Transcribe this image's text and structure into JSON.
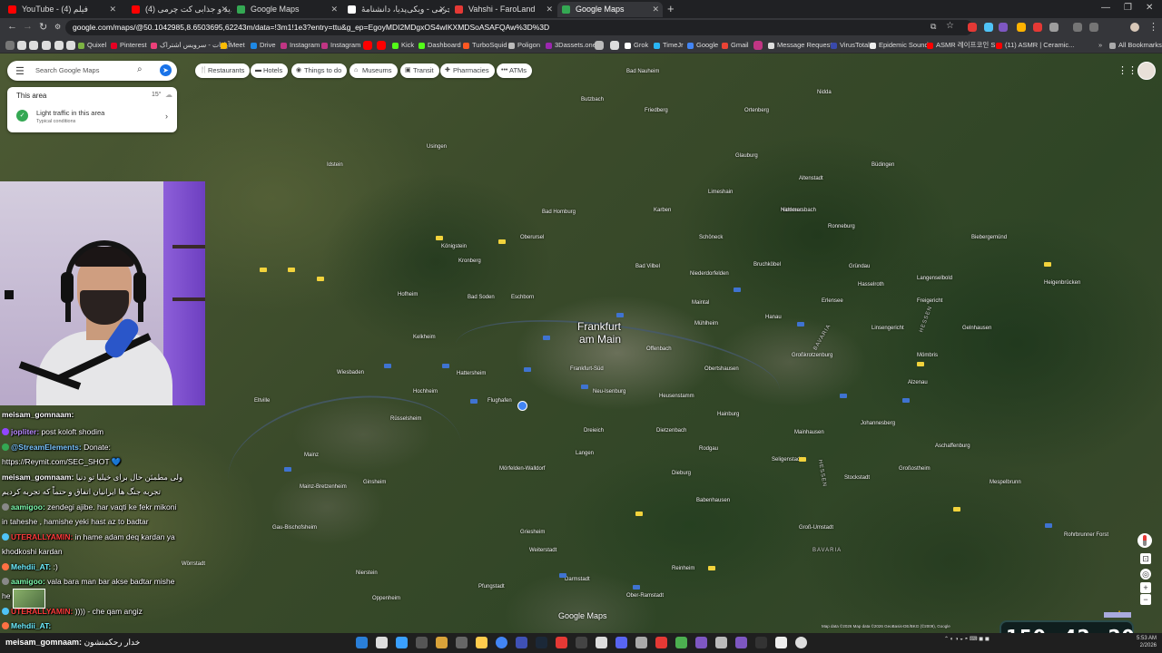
{
  "browser": {
    "tabs": [
      {
        "title": "YouTube - فیلم (4)",
        "color": "#ff0000",
        "active": false
      },
      {
        "title": "فیلم جدید و جذابی کت چرمی (4)",
        "color": "#ff0000",
        "active": false
      },
      {
        "title": "Google Maps",
        "color": "#34a853",
        "active": false
      },
      {
        "title": "کت چرمی - ویکی‌پدیا، دانشنامهٔ",
        "color": "#ffffff",
        "active": false
      },
      {
        "title": "Vahshi - FaroLand",
        "color": "#e53935",
        "active": false
      },
      {
        "title": "Google Maps",
        "color": "#34a853",
        "active": true
      }
    ],
    "url": "google.com/maps/@50.1042985,8.6503695,62243m/data=!3m1!1e3?entry=ttu&g_ep=EgoyMDI2MDgxOS4wIKXMDSoASAFQAw%3D%3D",
    "bookmarks": [
      "Quixel",
      "Pinterest",
      "آپارات - سرویس اشتراک",
      "Meet",
      "Drive",
      "Instagram",
      "Instagram",
      "Kick",
      "Dashboard",
      "TurboSquid",
      "Poligon",
      "3Dassets.one",
      "Grok",
      "TimeJr",
      "Google",
      "Gmail",
      "Message Requests",
      "VirusTotal",
      "Epidemic Sound",
      "ASMR 레이프코인 S...",
      "(11) ASMR | Ceramic...",
      "All Bookmarks"
    ]
  },
  "maps": {
    "search_placeholder": "Search Google Maps",
    "chips": [
      "Restaurants",
      "Hotels",
      "Things to do",
      "Museums",
      "Transit",
      "Pharmacies",
      "ATMs"
    ],
    "area_card": {
      "title": "This area",
      "temp": "15°",
      "traffic": "Light traffic in this area",
      "conditions": "Typical conditions"
    },
    "logo": "Google Maps",
    "attribution": "Map data ©2026  Map data ©2026 GeoBasis-DE/BKG (©2009), Google",
    "cities": {
      "main1": "Frankfurt",
      "main2": "am Main"
    },
    "towns": [
      "Bad Nauheim",
      "Friedberg",
      "Bad Homburg",
      "Oberursel",
      "Königstein",
      "Kronberg",
      "Bad Soden",
      "Eschborn",
      "Wiesbaden",
      "Mainz",
      "Hanau",
      "Offenbach",
      "Darmstadt",
      "Neu-Isenburg",
      "Dreieich",
      "Langen",
      "Rüsselsheim",
      "Flughafen",
      "Hofheim",
      "Karben",
      "Bad Vilbel",
      "Maintal",
      "Bruchköbel",
      "Dietzenbach",
      "Seligenstadt",
      "Babenhausen",
      "Rodgau",
      "Mörfelden-Walldorf",
      "Idstein",
      "Usingen",
      "Butzbach",
      "Gelnhausen",
      "Alzenau",
      "Aschaffenburg",
      "Dieburg",
      "Groß-Umstadt",
      "Griesheim",
      "Weiterstadt",
      "Nidda",
      "Büdingen",
      "Langenselbold",
      "Erlensee",
      "Nidderau",
      "Schöneck",
      "Niederdorfelden",
      "Obertshausen",
      "Heusenstamm",
      "Mühlheim",
      "Kelkheim",
      "Hattersheim",
      "Hochheim",
      "Eltville",
      "Ginsheim",
      "Nierstein",
      "Oppenheim",
      "Gau-Bischofsheim",
      "Wörrstadt",
      "Frankfurt-Süd",
      "Mainz-Bretzenheim",
      "Pfungstadt",
      "Ober-Ramstadt",
      "Reinheim",
      "Johannesberg",
      "Glauburg",
      "Ortenberg",
      "Altenstadt",
      "Limeshain",
      "Hammersbach",
      "Ronneburg",
      "Gründau",
      "Hasselroth",
      "Freigericht",
      "Biebergemünd",
      "Linsengericht",
      "Großkrotzenburg",
      "Hainburg",
      "Mainhausen",
      "Stockstadt",
      "Großostheim",
      "Mömbris",
      "Mespelbrunn",
      "Rohrbrunner Forst",
      "Heigenbrücken"
    ],
    "states": [
      "HESSEN",
      "BAVARIA",
      "HESSEN",
      "BAVARIA"
    ]
  },
  "chat": {
    "messages": [
      {
        "user": "meisam_gomnaam:",
        "text": "",
        "color": "#ffffff"
      },
      {
        "user": "jopliter:",
        "text": " post koloft shodim",
        "color": "#ffffff"
      },
      {
        "user": "@StreamElements:",
        "text": " Donate:",
        "color": "#7bc6ff"
      },
      {
        "user": "",
        "text": "https://Reymit.com/SEC_SHOT 💙",
        "color": "#ffffff"
      },
      {
        "user": "meisam_gomnaam:",
        "text": " ولی مطمئن حال برای خیلیا تو دنیا",
        "color": "#ffffff"
      },
      {
        "user": "",
        "text": "تجربه جنگ ها ایرانیان اتفاق و حتماً که تجربه کردیم",
        "color": "#ffffff"
      },
      {
        "user": "aamigoo:",
        "text": " zendegi ajibe. har vaqti ke fekr mikoni",
        "color": "#7fffb0"
      },
      {
        "user": "",
        "text": "in taheshe , hamishe yeki hast az to badtar",
        "color": "#ffffff"
      },
      {
        "user": "UTERALLYAMIN:",
        "text": " in hame adam deq kardan ya",
        "color": "#ff3b3b"
      },
      {
        "user": "",
        "text": "khodkoshi kardan",
        "color": "#ffffff"
      },
      {
        "user": "Mehdii_AT:",
        "text": " :)",
        "color": "#6ef0ff"
      },
      {
        "user": "aamigoo:",
        "text": " vala bara man bar akse badtar mishe",
        "color": "#7fffb0"
      },
      {
        "user": "",
        "text": "he",
        "color": "#ffffff"
      },
      {
        "user": "UTERALLYAMIN:",
        "text": " )))) - che qam angiz",
        "color": "#ff3b3b"
      },
      {
        "user": "Mehdii_AT:",
        "text": "",
        "color": "#6ef0ff"
      },
      {
        "user": "meisam_gomnaam:",
        "text": " خدار رحکمتشون",
        "color": "#ffffff"
      }
    ]
  },
  "timer": {
    "h": "150",
    "m": "42",
    "s": "20"
  },
  "taskbar": {
    "clock_time": "5:53 AM",
    "clock_date": "2/2026"
  }
}
